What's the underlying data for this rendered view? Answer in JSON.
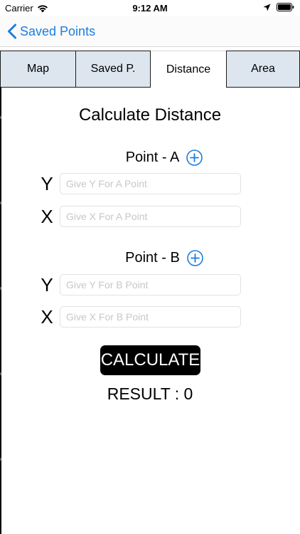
{
  "status_bar": {
    "carrier": "Carrier",
    "time": "9:12 AM"
  },
  "nav": {
    "back_label": "Saved Points"
  },
  "tabs": [
    {
      "label": "Map",
      "active": false
    },
    {
      "label": "Saved P.",
      "active": false
    },
    {
      "label": "Distance",
      "active": true
    },
    {
      "label": "Area",
      "active": false
    }
  ],
  "main": {
    "title": "Calculate Distance",
    "point_a": {
      "label": "Point - A",
      "y_label": "Y",
      "y_placeholder": "Give Y For A Point",
      "y_value": "",
      "x_label": "X",
      "x_placeholder": "Give X For A Point",
      "x_value": ""
    },
    "point_b": {
      "label": "Point - B",
      "y_label": "Y",
      "y_placeholder": "Give Y For B Point",
      "y_value": "",
      "x_label": "X",
      "x_placeholder": "Give X For B Point",
      "x_value": ""
    },
    "calculate_label": "CALCULATE",
    "result_text": "RESULT : 0"
  },
  "colors": {
    "accent": "#1a7de0",
    "tab_bg": "#dde6ef",
    "button_bg": "#000000"
  }
}
